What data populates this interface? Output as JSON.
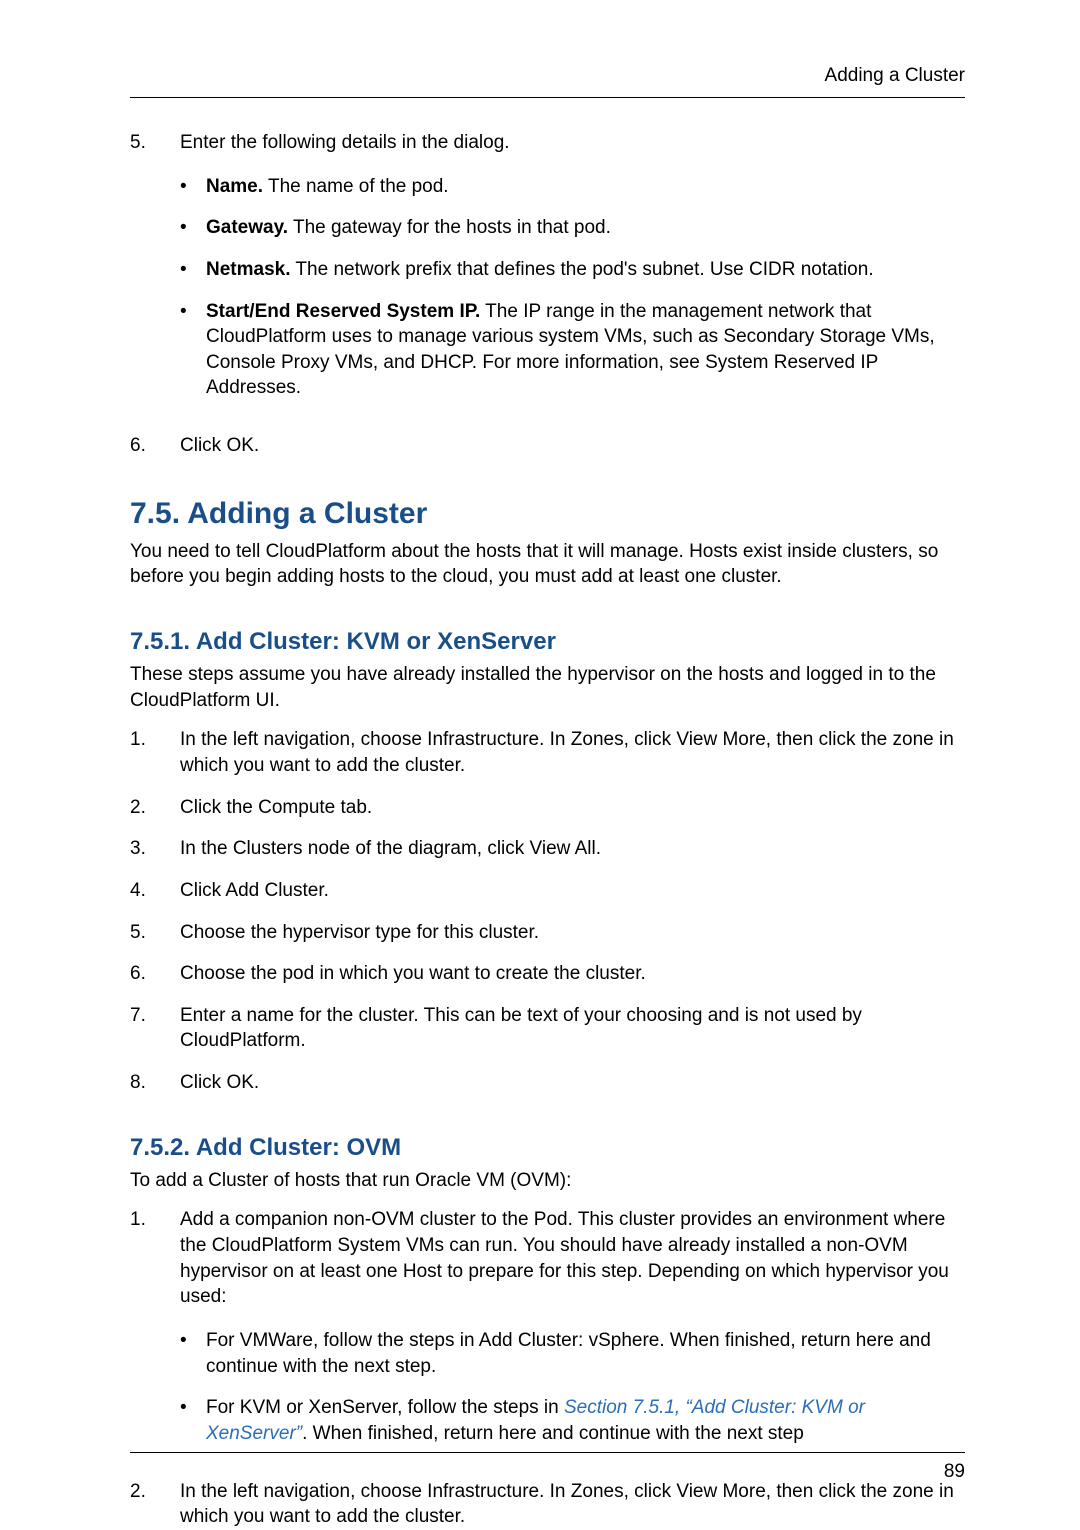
{
  "running_header": "Adding a Cluster",
  "page_number": "89",
  "top_list": {
    "item5": {
      "num": "5.",
      "lead": "Enter the following details in the dialog.",
      "bullets": {
        "b1_bold": "Name.",
        "b1_rest": " The name of the pod.",
        "b2_bold": "Gateway.",
        "b2_rest": " The gateway for the hosts in that pod.",
        "b3_bold": "Netmask.",
        "b3_rest": " The network prefix that defines the pod's subnet. Use CIDR notation.",
        "b4_bold": "Start/End Reserved System IP.",
        "b4_rest": " The IP range in the management network that CloudPlatform uses to manage various system VMs, such as Secondary Storage VMs, Console Proxy VMs, and DHCP. For more information, see System Reserved IP Addresses."
      }
    },
    "item6": {
      "num": "6.",
      "text": "Click OK."
    }
  },
  "section75": {
    "title": "7.5. Adding a Cluster",
    "intro": "You need to tell CloudPlatform about the hosts that it will manage. Hosts exist inside clusters, so before you begin adding hosts to the cloud, you must add at least one cluster."
  },
  "section751": {
    "title": "7.5.1. Add Cluster: KVM or XenServer",
    "intro": "These steps assume you have already installed the hypervisor on the hosts and logged in to the CloudPlatform UI.",
    "steps": {
      "s1": {
        "num": "1.",
        "text": "In the left navigation, choose Infrastructure. In Zones, click View More, then click the zone in which you want to add the cluster."
      },
      "s2": {
        "num": "2.",
        "text": "Click the Compute tab."
      },
      "s3": {
        "num": "3.",
        "text": "In the Clusters node of the diagram, click View All."
      },
      "s4": {
        "num": "4.",
        "text": "Click Add Cluster."
      },
      "s5": {
        "num": "5.",
        "text": "Choose the hypervisor type for this cluster."
      },
      "s6": {
        "num": "6.",
        "text": "Choose the pod in which you want to create the cluster."
      },
      "s7": {
        "num": "7.",
        "text": "Enter a name for the cluster. This can be text of your choosing and is not used by CloudPlatform."
      },
      "s8": {
        "num": "8.",
        "text": "Click OK."
      }
    }
  },
  "section752": {
    "title": "7.5.2. Add Cluster: OVM",
    "intro": "To add a Cluster of hosts that run Oracle VM (OVM):",
    "steps": {
      "s1": {
        "num": "1.",
        "lead": "Add a companion non-OVM cluster to the Pod. This cluster provides an environment where the CloudPlatform System VMs can run. You should have already installed a non-OVM hypervisor on at least one Host to prepare for this step. Depending on which hypervisor you used:",
        "bullets": {
          "b1": "For VMWare, follow the steps in Add Cluster: vSphere. When finished, return here and continue with the next step.",
          "b2_pre": "For KVM or XenServer, follow the steps in ",
          "b2_xref": "Section 7.5.1, “Add Cluster: KVM or XenServer”",
          "b2_post": ". When finished, return here and continue with the next step"
        }
      },
      "s2": {
        "num": "2.",
        "text": "In the left navigation, choose Infrastructure. In Zones, click View More, then click the zone in which you want to add the cluster."
      }
    }
  }
}
